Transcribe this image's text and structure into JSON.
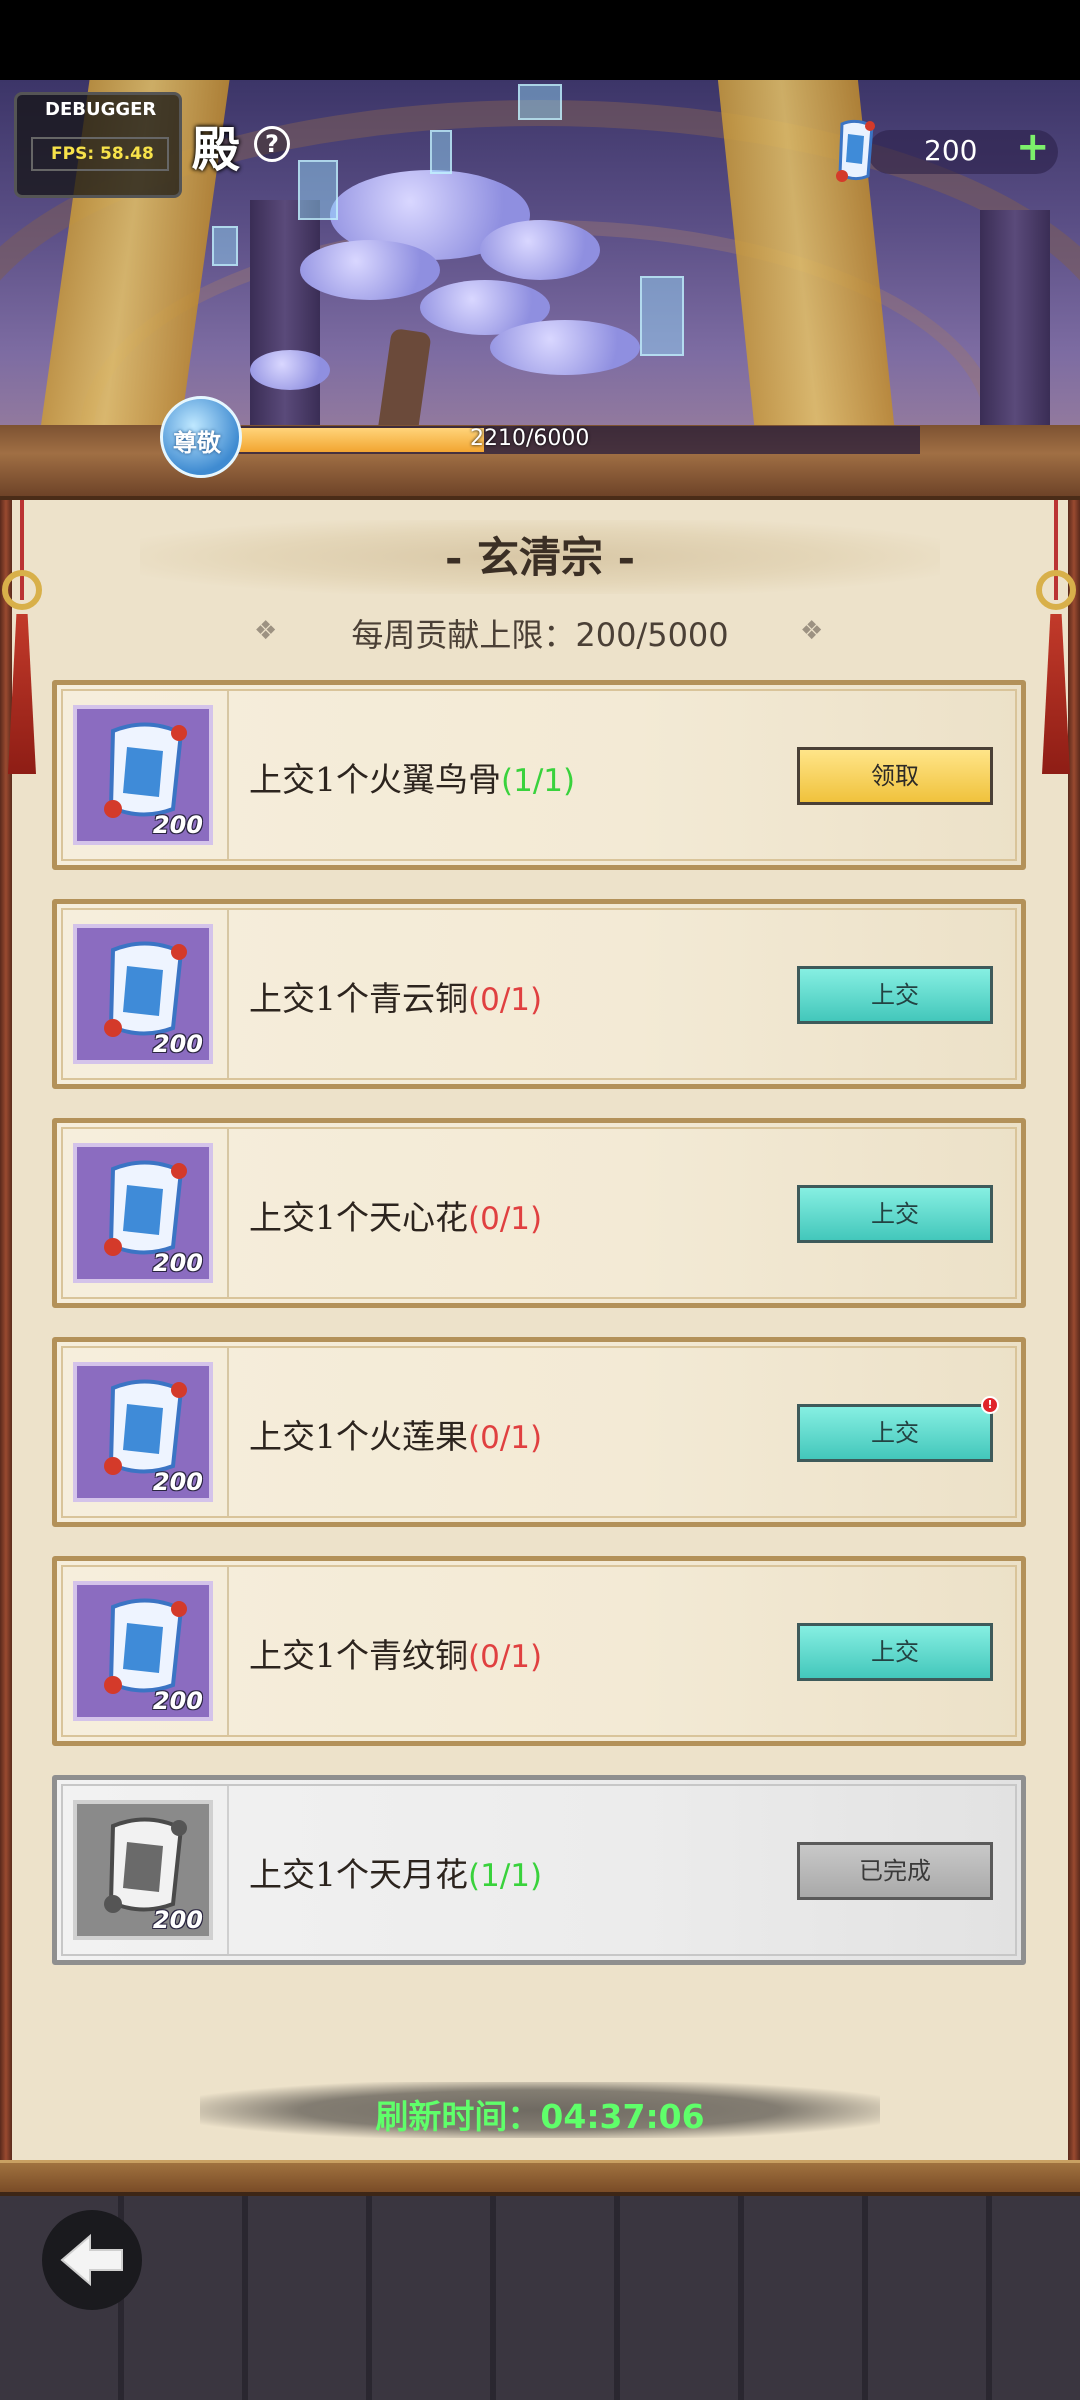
{
  "debugger": {
    "title": "DEBUGGER",
    "fps": "FPS: 58.48"
  },
  "header": {
    "title_char": "殿",
    "help_symbol": "?"
  },
  "currency": {
    "value": "200",
    "plus": "+"
  },
  "reverence": {
    "badge": "尊敬",
    "current": 2210,
    "max": 6000,
    "text": "2210/6000"
  },
  "sect": {
    "name": "- 玄清宗 -"
  },
  "weekly_limit": {
    "text": "每周贡献上限：200/5000",
    "ornament": "❖"
  },
  "tasks": [
    {
      "text": "上交1个火翼鸟骨",
      "progress": "(1/1)",
      "reward": "200",
      "button": "领取"
    },
    {
      "text": "上交1个青云铜",
      "progress": "(0/1)",
      "reward": "200",
      "button": "上交"
    },
    {
      "text": "上交1个天心花",
      "progress": "(0/1)",
      "reward": "200",
      "button": "上交"
    },
    {
      "text": "上交1个火莲果",
      "progress": "(0/1)",
      "reward": "200",
      "button": "上交",
      "badge": "!"
    },
    {
      "text": "上交1个青纹铜",
      "progress": "(0/1)",
      "reward": "200",
      "button": "上交"
    },
    {
      "text": "上交1个天月花",
      "progress": "(1/1)",
      "reward": "200",
      "button": "已完成"
    }
  ],
  "refresh": {
    "text": "刷新时间：04:37:06"
  },
  "colors": {
    "progress_done": "#39d23c",
    "progress_todo": "#e04040",
    "claim_button": "#f0c23c",
    "submit_button": "#43c7bb",
    "finished_button": "#a9a9a9"
  },
  "icons": {
    "back": "back-arrow-icon",
    "reward": "scroll-token-icon",
    "help": "question-icon"
  }
}
